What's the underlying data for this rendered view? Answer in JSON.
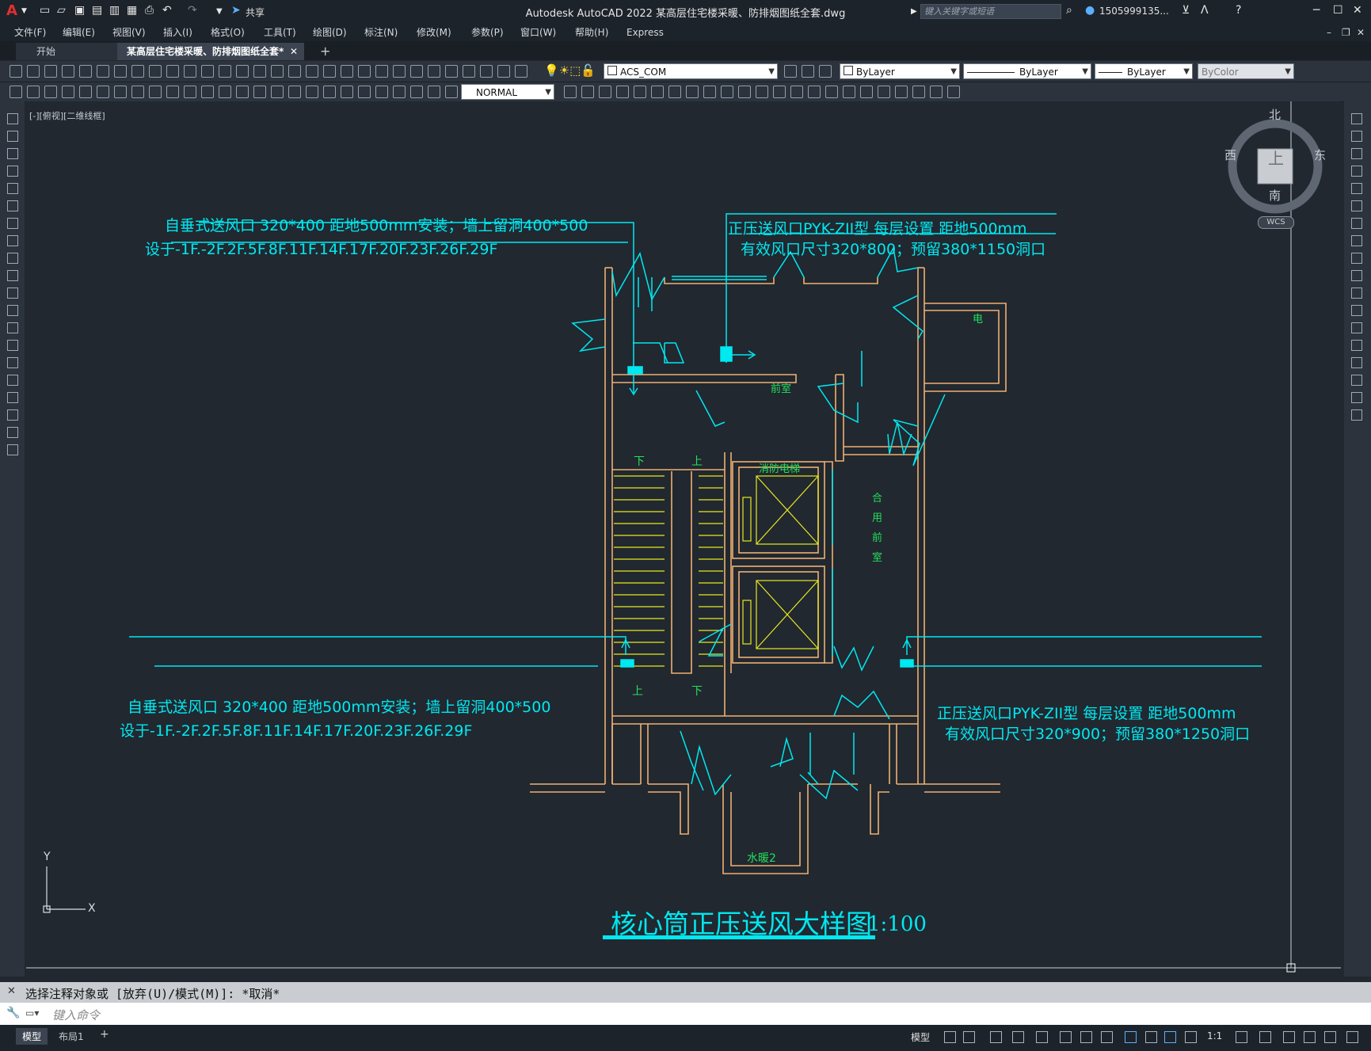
{
  "app": {
    "title": "Autodesk AutoCAD 2022    某高层住宅楼采暖、防排烟图纸全套.dwg",
    "share_label": "共享",
    "search_placeholder": "键入关键字或短语",
    "user": "1505999135...",
    "logo": "A"
  },
  "menu": [
    "文件(F)",
    "编辑(E)",
    "视图(V)",
    "插入(I)",
    "格式(O)",
    "工具(T)",
    "绘图(D)",
    "标注(N)",
    "修改(M)",
    "参数(P)",
    "窗口(W)",
    "帮助(H)",
    "Express"
  ],
  "tabs": [
    {
      "label": "开始"
    },
    {
      "label": "某高层住宅楼采暖、防排烟图纸全套*"
    }
  ],
  "toolbar": {
    "layer": "ACS_COM",
    "color": "ByLayer",
    "linetype": "ByLayer",
    "lineweight": "ByLayer",
    "plotstyle": "ByColor",
    "textstyle": "NORMAL"
  },
  "viewport": {
    "label": "[-][俯视][二维线框]",
    "compass": {
      "n": "北",
      "s": "南",
      "e": "东",
      "w": "西",
      "center": "上",
      "wcs": "WCS"
    },
    "ucs": {
      "x": "X",
      "y": "Y"
    }
  },
  "drawing": {
    "note_tl_1": "自垂式送风口 320*400 距地500mm安装；墙上留洞400*500",
    "note_tl_2": "设于-1F.-2F.2F.5F.8F.11F.14F.17F.20F.23F.26F.29F",
    "note_tr_1": "正压送风口PYK-ZII型 每层设置 距地500mm",
    "note_tr_2": "有效风口尺寸320*800；预留380*1150洞口",
    "note_bl_1": "自垂式送风口 320*400 距地500mm安装；墙上留洞400*500",
    "note_bl_2": "设于-1F.-2F.2F.5F.8F.11F.14F.17F.20F.23F.26F.29F",
    "note_br_1": "正压送风口PYK-ZII型 每层设置 距地500mm",
    "note_br_2": "有效风口尺寸320*900；预留380*1250洞口",
    "room_elec": "电",
    "room_lobby": "前室",
    "room_fire_elevator": "消防电梯",
    "room_shared_lobby": [
      "合",
      "用",
      "前",
      "室"
    ],
    "room_water": "水暖2",
    "stair_down_top": "下",
    "stair_up_top": "上",
    "stair_up_bottom": "上",
    "stair_down_bottom": "下",
    "title": "核心筒正压送风大样图",
    "scale": "1:100"
  },
  "command": {
    "history": "选择注释对象或 [放弃(U)/模式(M)]: *取消*",
    "placeholder": "键入命令"
  },
  "layout_tabs": [
    "模型",
    "布局1"
  ],
  "status": {
    "model": "模型",
    "scale": "1:1"
  },
  "colors": {
    "cyan": "#00e8f0",
    "wall": "#f0b070",
    "green": "#22e05a",
    "yellow": "#e8e820",
    "background": "#212830"
  }
}
